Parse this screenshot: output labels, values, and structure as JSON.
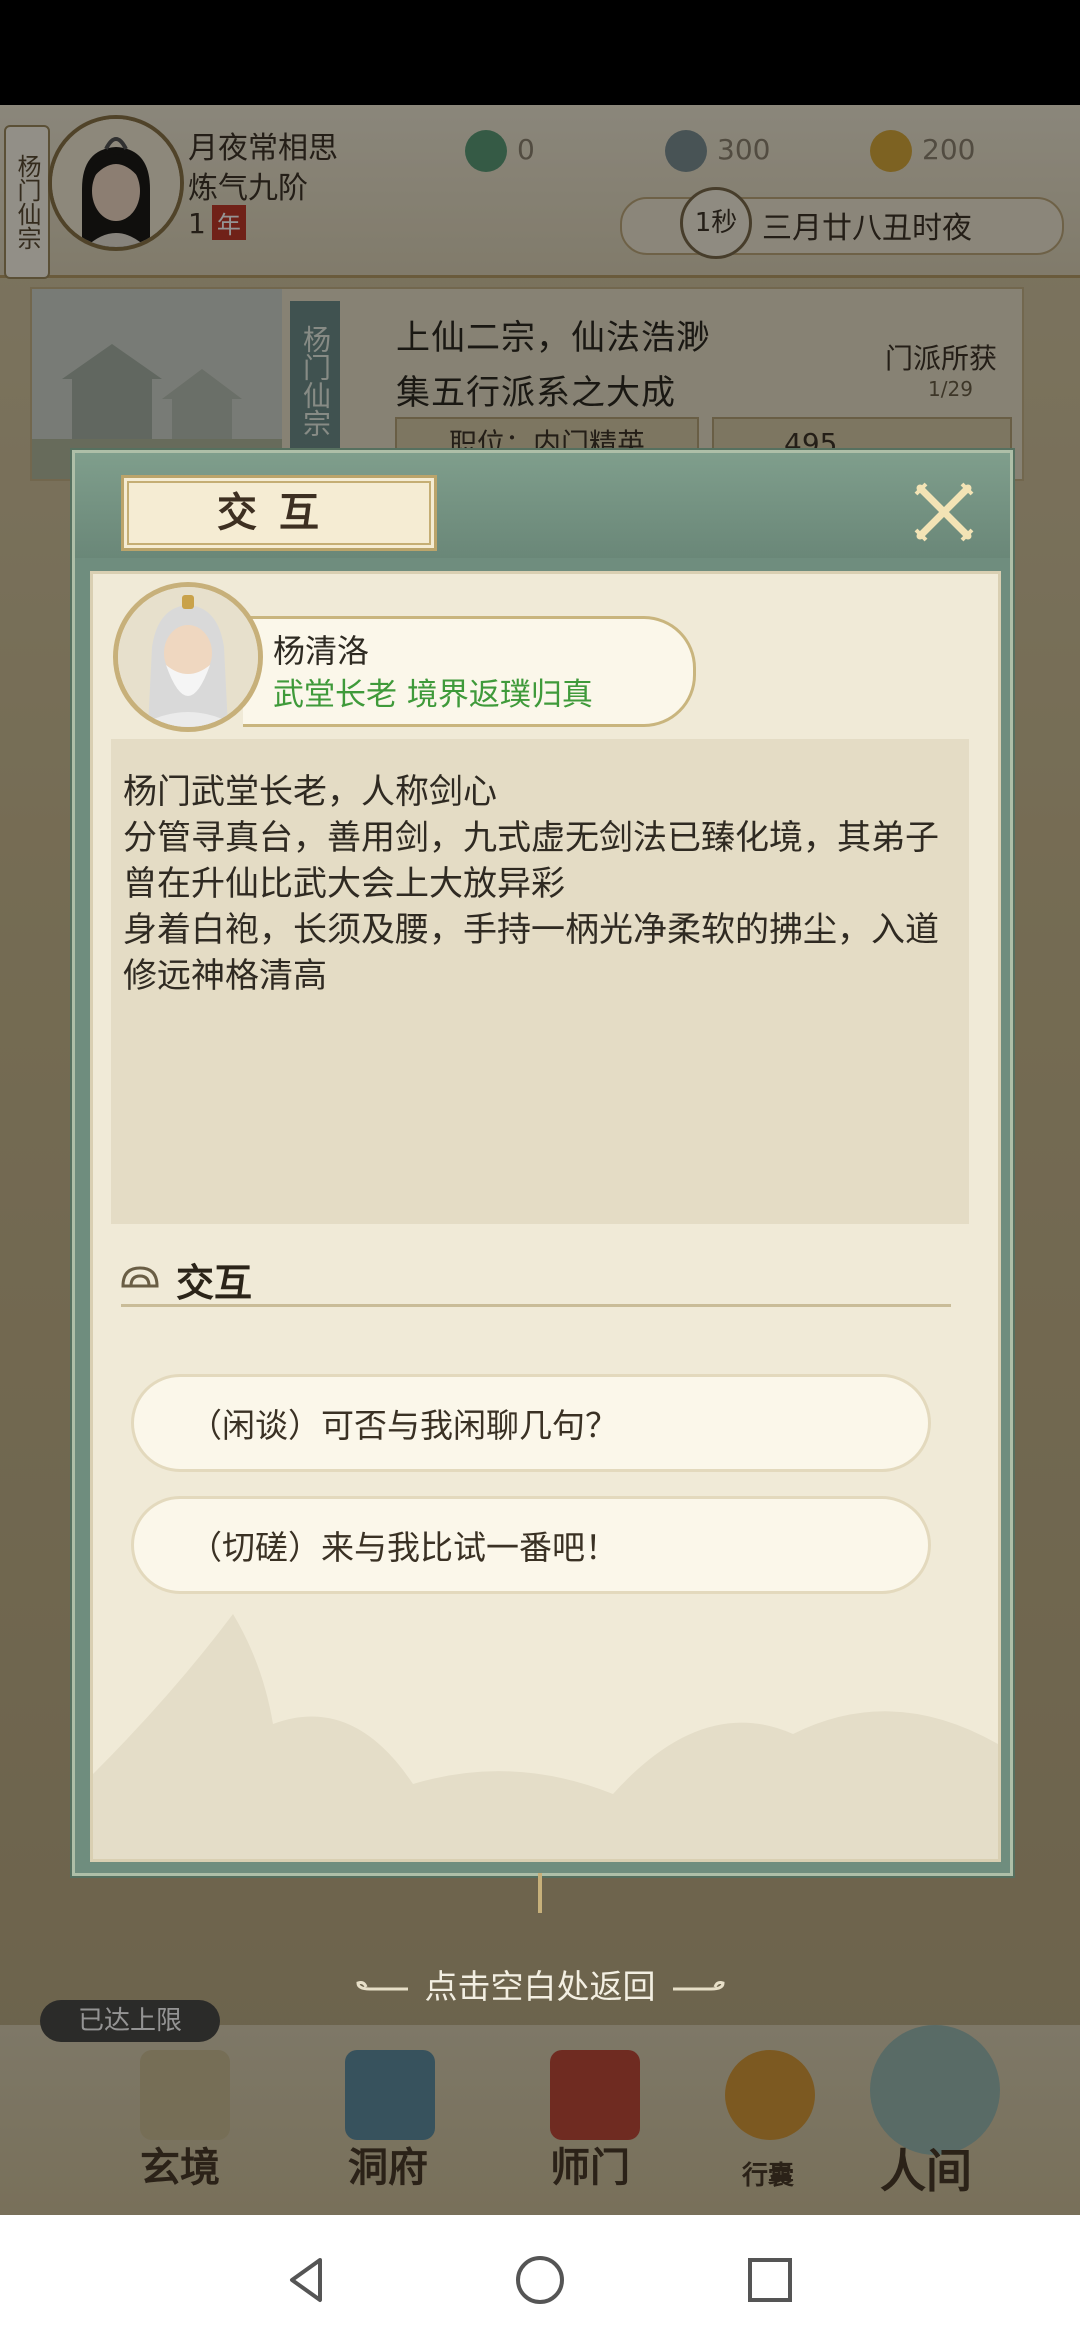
{
  "player": {
    "sect_tag": "杨门仙宗",
    "name": "月夜常相思",
    "realm": "炼气九阶",
    "years_prefix": "1",
    "years_unit": "年"
  },
  "resources": [
    {
      "name": "spirit-stone-icon",
      "value": "0"
    },
    {
      "name": "coin-icon",
      "value": "300"
    },
    {
      "name": "gold-ingot-icon",
      "value": "200"
    }
  ],
  "time": {
    "speed": "1秒",
    "date": "三月廿八丑时夜"
  },
  "sect": {
    "vertical_name": "杨门仙宗",
    "motto_line1": "上仙二宗，仙法浩渺",
    "motto_line2": "集五行派系之大成",
    "harvest_label": "门派所获",
    "harvest_count": "1/29",
    "position": "职位：内门精英",
    "resource_value": "495"
  },
  "dialog": {
    "title": "交互",
    "npc": {
      "name": "杨清洛",
      "title": "武堂长老  境界返璞归真",
      "desc": [
        "  杨门武堂长老，人称剑心",
        "  分管寻真台，善用剑，九式虚无剑法已臻化境，其弟子曾在升仙比武大会上大放异彩",
        "  身着白袍，长须及腰，手持一柄光净柔软的拂尘，入道修远神格清高"
      ]
    },
    "section_label": "交互",
    "options": [
      "（闲谈）可否与我闲聊几句？",
      "（切磋）来与我比试一番吧！"
    ]
  },
  "return_hint": "点击空白处返回",
  "bottom_menu": {
    "limit_badge": "已达上限",
    "items": [
      "玄境",
      "洞府",
      "师门",
      "行囊",
      "人间"
    ]
  },
  "colors": {
    "dialog_frame": "#6f8d7e",
    "dialog_body": "#f0ead7",
    "npc_title_green": "#3f9a3a",
    "badge_red": "#c23a2a"
  }
}
